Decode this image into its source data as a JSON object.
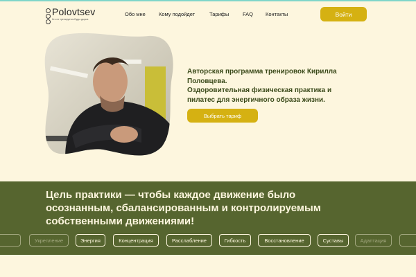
{
  "header": {
    "logo_name": "Polovtsev",
    "logo_sub": "Кто не тренируется Будь здоров",
    "nav": [
      "Обо мне",
      "Кому подойдет",
      "Тарифы",
      "FAQ",
      "Контакты"
    ],
    "login_label": "Войти"
  },
  "hero": {
    "lines": [
      "Авторская программа тренировок Кирилла",
      "Половцева.",
      "Оздоровительная физическая практика и",
      "пилатес для энергичного образа жизни."
    ],
    "cta_label": "Выбрать тариф"
  },
  "goal": {
    "lines": [
      "Цель практики — чтобы каждое движение было",
      "осознанным, сбалансированным и контролируемым",
      "собственными движениями!"
    ],
    "chips": [
      "Укрепление",
      "Энергия",
      "Концентрация",
      "Расслабление",
      "Гибкость",
      "Восстановление",
      "Суставы",
      "Адаптация"
    ]
  },
  "colors": {
    "background": "#fdf6de",
    "accent": "#d5b112",
    "band": "#56652f",
    "heading": "#3b4a1a"
  }
}
